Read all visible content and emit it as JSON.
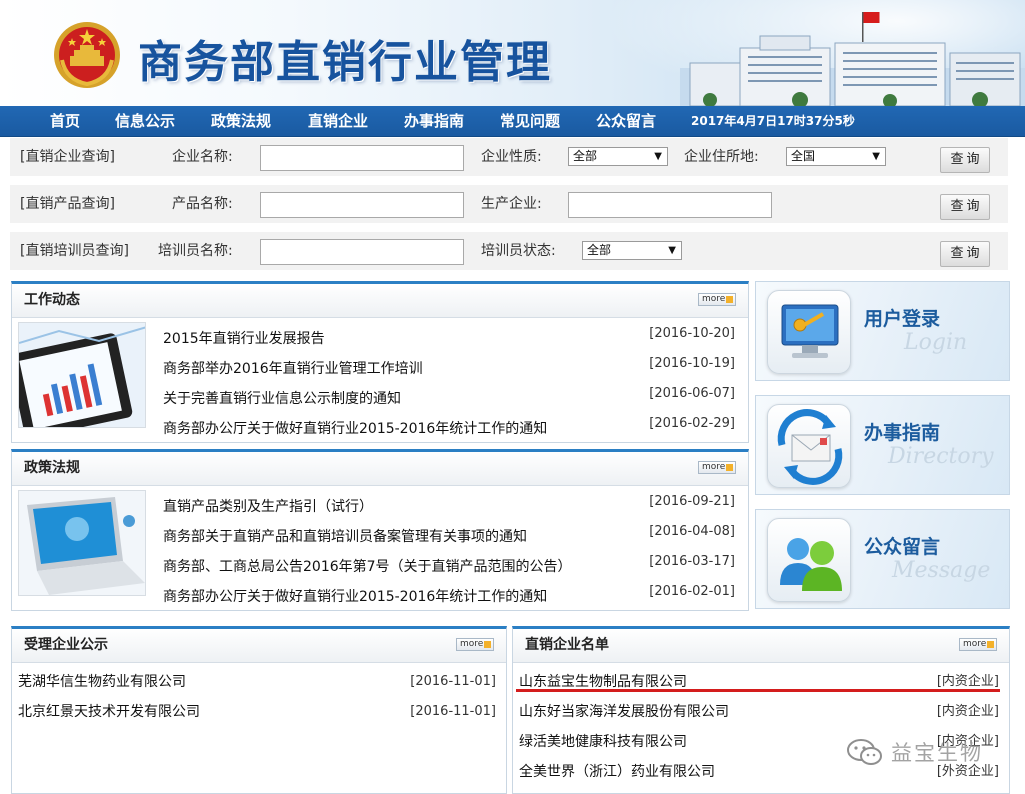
{
  "header": {
    "site_title": "商务部直销行业管理",
    "emblem_icon": "national-emblem-icon",
    "flag_icon": "red-flag-icon"
  },
  "nav": {
    "items": [
      "首页",
      "信息公示",
      "政策法规",
      "直销企业",
      "办事指南",
      "常见问题",
      "公众留言"
    ],
    "datetime": "2017年4月7日17时37分5秒"
  },
  "queries": {
    "company": {
      "section_label": "[直销企业查询]",
      "name_label": "企业名称:",
      "name_value": "",
      "type_label": "企业性质:",
      "type_value": "全部",
      "location_label": "企业住所地:",
      "location_value": "全国",
      "button": "查询"
    },
    "product": {
      "section_label": "[直销产品查询]",
      "name_label": "产品名称:",
      "name_value": "",
      "maker_label": "生产企业:",
      "maker_value": "",
      "button": "查询"
    },
    "trainer": {
      "section_label": "[直销培训员查询]",
      "name_label": "培训员名称:",
      "name_value": "",
      "status_label": "培训员状态:",
      "status_value": "全部",
      "button": "查询"
    }
  },
  "work_news": {
    "title": "工作动态",
    "more": "more",
    "items": [
      {
        "title": "2015年直销行业发展报告",
        "date": "[2016-10-20]"
      },
      {
        "title": "商务部举办2016年直销行业管理工作培训",
        "date": "[2016-10-19]"
      },
      {
        "title": "关于完善直销行业信息公示制度的通知",
        "date": "[2016-06-07]"
      },
      {
        "title": "商务部办公厅关于做好直销行业2015-2016年统计工作的通知",
        "date": "[2016-02-29]"
      }
    ]
  },
  "policy": {
    "title": "政策法规",
    "more": "more",
    "items": [
      {
        "title": "直销产品类别及生产指引（试行）",
        "date": "[2016-09-21]"
      },
      {
        "title": "商务部关于直销产品和直销培训员备案管理有关事项的通知",
        "date": "[2016-04-08]"
      },
      {
        "title": "商务部、工商总局公告2016年第7号（关于直销产品范围的公告）",
        "date": "[2016-03-17]"
      },
      {
        "title": "商务部办公厅关于做好直销行业2015-2016年统计工作的通知",
        "date": "[2016-02-01]"
      }
    ]
  },
  "side_cards": [
    {
      "cn": "用户登录",
      "en": "Login",
      "icon": "login-monitor-icon"
    },
    {
      "cn": "办事指南",
      "en": "Directory",
      "icon": "envelope-refresh-icon"
    },
    {
      "cn": "公众留言",
      "en": "Message",
      "icon": "users-message-icon"
    }
  ],
  "accepted": {
    "title": "受理企业公示",
    "more": "more",
    "items": [
      {
        "name": "芜湖华信生物药业有限公司",
        "right": "[2016-11-01]"
      },
      {
        "name": "北京红景天技术开发有限公司",
        "right": "[2016-11-01]"
      }
    ]
  },
  "companies": {
    "title": "直销企业名单",
    "more": "more",
    "items": [
      {
        "name": "山东益宝生物制品有限公司",
        "right": "[内资企业]"
      },
      {
        "name": "山东好当家海洋发展股份有限公司",
        "right": "[内资企业]"
      },
      {
        "name": "绿活美地健康科技有限公司",
        "right": "[内资企业]"
      },
      {
        "name": "全美世界（浙江）药业有限公司",
        "right": "[外资企业]"
      }
    ]
  },
  "watermark": {
    "text": "益宝生物",
    "icon": "wechat-icon"
  }
}
